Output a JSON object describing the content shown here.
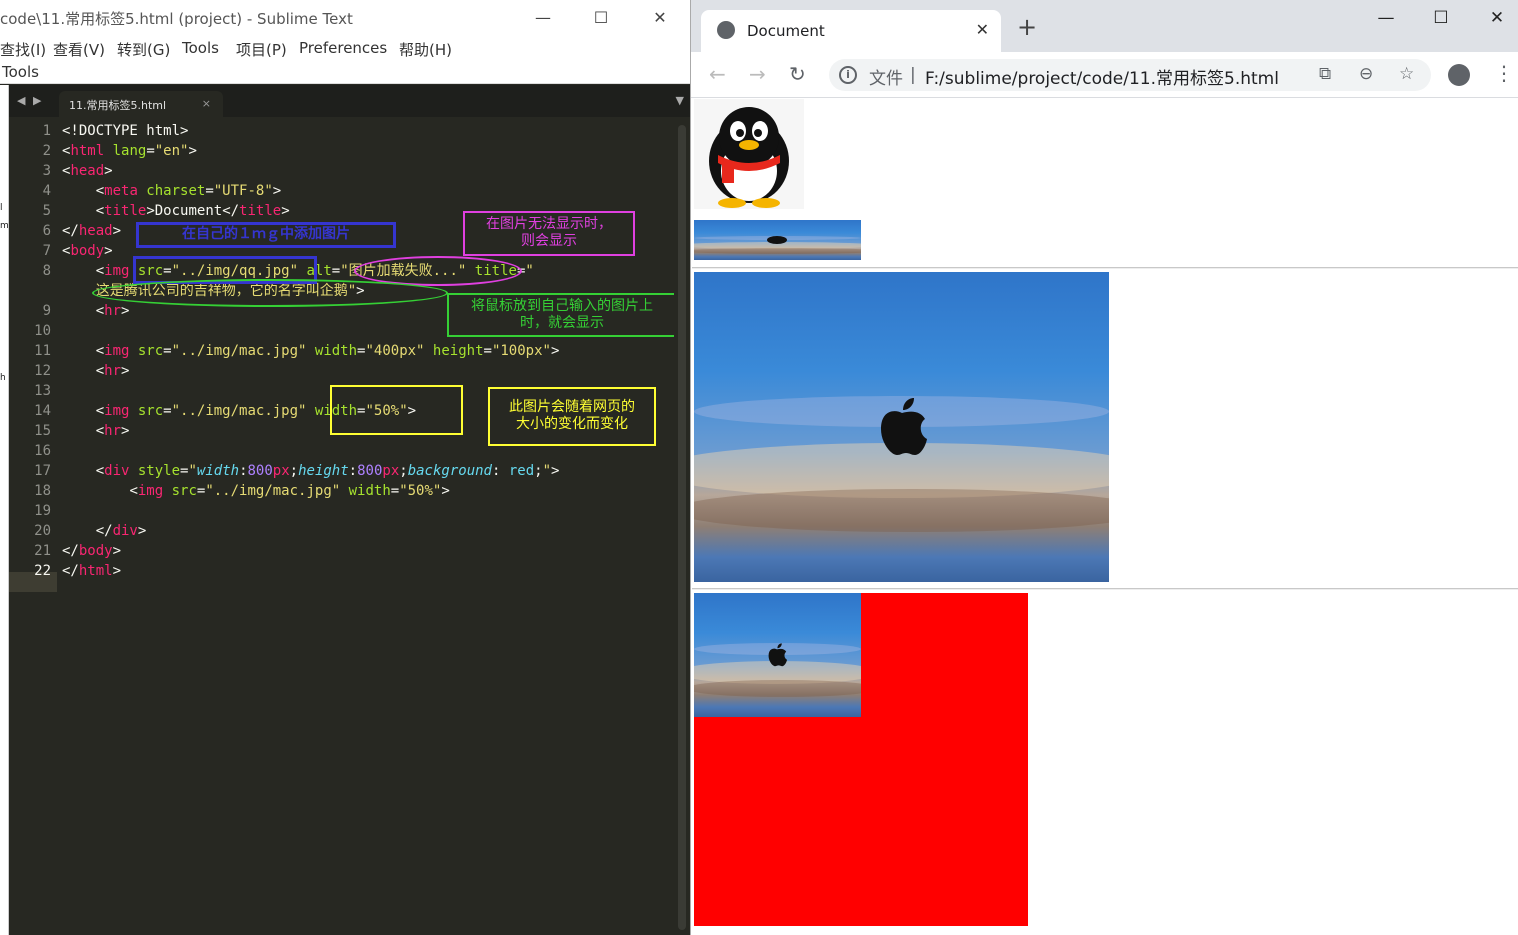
{
  "sublime": {
    "title": "code\\11.常用标签5.html (project) - Sublime Text",
    "window_buttons": [
      "—",
      "☐",
      "✕"
    ],
    "menu": [
      "查找(I)",
      "查看(V)",
      "转到(G)",
      "Tools",
      "项目(P)",
      "Preferences",
      "帮助(H)"
    ],
    "toolsbar_label": "Tools",
    "sidebar_chars": [
      "l",
      "m",
      "h"
    ],
    "tab": {
      "label": "11.常用标签5.html",
      "close": "×"
    },
    "tab_nav": [
      "◀",
      "▶"
    ],
    "tab_dropdown": "▼",
    "line_numbers": [
      "1",
      "2",
      "3",
      "4",
      "5",
      "6",
      "7",
      "8",
      "",
      "9",
      "10",
      "11",
      "12",
      "13",
      "14",
      "15",
      "16",
      "17",
      "18",
      "19",
      "20",
      "21",
      "22"
    ],
    "active_line": "22",
    "code": {
      "l1": "<!DOCTYPE html>",
      "l2_lt": "<",
      "l2_tag": "html",
      "l2_attr": " lang",
      "l2_eq": "=",
      "l2_val": "\"en\"",
      "l2_gt": ">",
      "l3_lt": "<",
      "l3_tag": "head",
      "l3_gt": ">",
      "l4_ind": "    ",
      "l4_lt": "<",
      "l4_tag": "meta",
      "l4_attr": " charset",
      "l4_eq": "=",
      "l4_val": "\"UTF-8\"",
      "l4_gt": ">",
      "l5_ind": "    ",
      "l5_lt": "<",
      "l5_tag": "title",
      "l5_gt1": ">",
      "l5_text": "Document",
      "l5_lt2": "</",
      "l5_tag2": "title",
      "l5_gt2": ">",
      "l6_lt": "</",
      "l6_tag": "head",
      "l6_gt": ">",
      "l7_lt": "<",
      "l7_tag": "body",
      "l7_gt": ">",
      "l8_ind": "    ",
      "l8_lt": "<",
      "l8_tag": "img",
      "l8_a1": " src",
      "l8_e1": "=",
      "l8_v1": "\"../img/qq.jpg\"",
      "l8_a2": " alt",
      "l8_e2": "=",
      "l8_v2": "\"图片加载失败...\"",
      "l8_a3": " title",
      "l8_e3": "=",
      "l8_v3": "\"",
      "l8b_ind": "    ",
      "l8b_v": "这是腾讯公司的吉祥物，它的名字叫企鹅\"",
      "l8b_gt": ">",
      "l9_ind": "    ",
      "l9_lt": "<",
      "l9_tag": "hr",
      "l9_gt": ">",
      "l11_ind": "    ",
      "l11_lt": "<",
      "l11_tag": "img",
      "l11_a1": " src",
      "l11_e1": "=",
      "l11_v1": "\"../img/mac.jpg\"",
      "l11_a2": " width",
      "l11_e2": "=",
      "l11_v2": "\"400px\"",
      "l11_a3": " height",
      "l11_e3": "=",
      "l11_v3": "\"100px\"",
      "l11_gt": ">",
      "l12_ind": "    ",
      "l12_lt": "<",
      "l12_tag": "hr",
      "l12_gt": ">",
      "l14_ind": "    ",
      "l14_lt": "<",
      "l14_tag": "img",
      "l14_a1": " src",
      "l14_e1": "=",
      "l14_v1": "\"../img/mac.jpg\"",
      "l14_a2": " width",
      "l14_e2": "=",
      "l14_v2": "\"50%\"",
      "l14_gt": ">",
      "l15_ind": "    ",
      "l15_lt": "<",
      "l15_tag": "hr",
      "l15_gt": ">",
      "l17_ind": "    ",
      "l17_lt": "<",
      "l17_tag": "div",
      "l17_a1": " style",
      "l17_e1": "=",
      "l17_q1": "\"",
      "l17_p1": "width",
      "l17_c1": ":",
      "l17_n1": "800",
      "l17_u1": "px",
      "l17_s1": ";",
      "l17_p2": "height",
      "l17_c2": ":",
      "l17_n2": "800",
      "l17_u2": "px",
      "l17_s2": ";",
      "l17_p3": "background",
      "l17_c3": ": ",
      "l17_v3": "red",
      "l17_s3": ";",
      "l17_q2": "\"",
      "l17_gt": ">",
      "l18_ind": "        ",
      "l18_lt": "<",
      "l18_tag": "img",
      "l18_a1": " src",
      "l18_e1": "=",
      "l18_v1": "\"../img/mac.jpg\"",
      "l18_a2": " width",
      "l18_e2": "=",
      "l18_v2": "\"50%\"",
      "l18_gt": ">",
      "l20_ind": "    ",
      "l20_lt": "</",
      "l20_tag": "div",
      "l20_gt": ">",
      "l21_lt": "</",
      "l21_tag": "body",
      "l21_gt": ">",
      "l22_lt": "</",
      "l22_tag": "html",
      "l22_gt": ">"
    },
    "annotations": {
      "blue_note": "在自己的１ｍｇ中添加图片",
      "magenta_note": "在图片无法显示时，\n则会显示",
      "green_note": "将鼠标放到自己输入的图片上\n时，就会显示",
      "yellow_note": "此图片会随着网页的\n大小的变化而变化"
    },
    "colors": {
      "bg": "#272822",
      "tag": "#f92672",
      "attr": "#a6e22e",
      "string": "#e6db74",
      "prop": "#66d9ef",
      "number": "#ae81ff",
      "ann_blue": "#3535d0",
      "ann_magenta": "#e040e0",
      "ann_green": "#35d035",
      "ann_yellow": "#ffff33"
    }
  },
  "chrome": {
    "tab_title": "Document",
    "tab_close": "✕",
    "new_tab": "+",
    "window_buttons": [
      "—",
      "☐",
      "✕"
    ],
    "nav": {
      "back": "←",
      "forward": "→",
      "reload": "↻"
    },
    "omnibox": {
      "info": "i",
      "label": "文件",
      "separator": "|",
      "url": "F:/sublime/project/code/11.常用标签5.html"
    },
    "actions": {
      "translate": "⧉",
      "zoom": "⊖",
      "bookmark": "☆"
    },
    "menu": "⋮",
    "page": {
      "qq_alt": "图片加载失败...",
      "qq_title": "这是腾讯公司的吉祥物，它的名字叫企鹅",
      "red_div_background": "#ff0000"
    }
  }
}
